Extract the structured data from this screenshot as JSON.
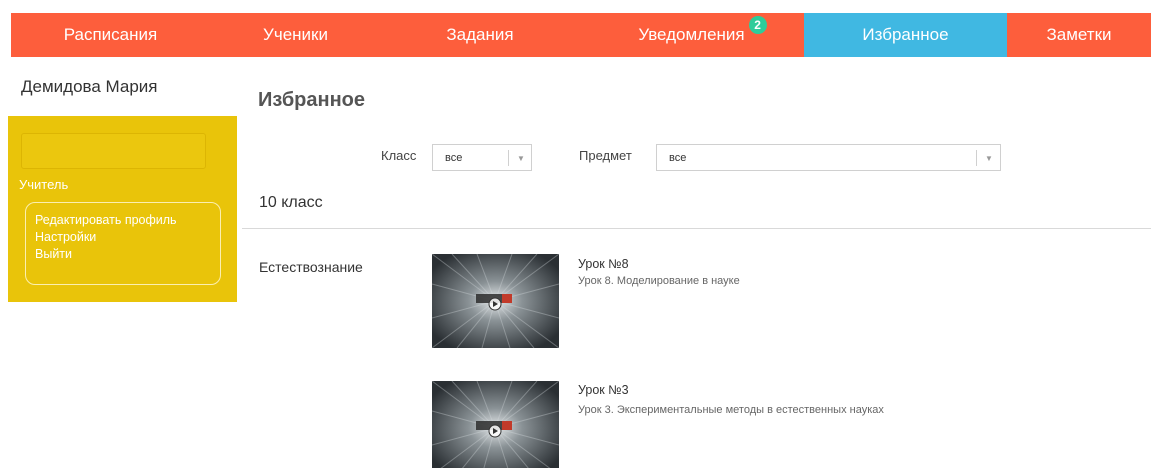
{
  "nav": {
    "items": [
      {
        "label": "Расписания"
      },
      {
        "label": "Ученики"
      },
      {
        "label": "Задания"
      },
      {
        "label": "Уведомления",
        "badge": "2"
      },
      {
        "label": "Избранное",
        "active": true
      },
      {
        "label": "Заметки"
      }
    ],
    "colors": {
      "accent": "#fd5e3c",
      "active": "#40b8e2",
      "badge": "#2ecc9a"
    }
  },
  "sidebar": {
    "user_name": "Демидова Мария",
    "role": "Учитель",
    "menu": [
      "Редактировать профиль",
      "Настройки",
      "Выйти"
    ],
    "card_color": "#e9c40a"
  },
  "main": {
    "title": "Избранное",
    "filters": {
      "class_label": "Класс",
      "class_value": "все",
      "subject_label": "Предмет",
      "subject_value": "все"
    },
    "group_heading": "10 класс",
    "subject_name": "Естествознание",
    "lessons": [
      {
        "title": "Урок №8",
        "description": "Урок 8. Моделирование в науке",
        "thumb_icon": "video-play-icon"
      },
      {
        "title": "Урок №3",
        "description": "Урок 3. Экспериментальные методы в естественных науках",
        "thumb_icon": "video-play-icon"
      }
    ]
  }
}
